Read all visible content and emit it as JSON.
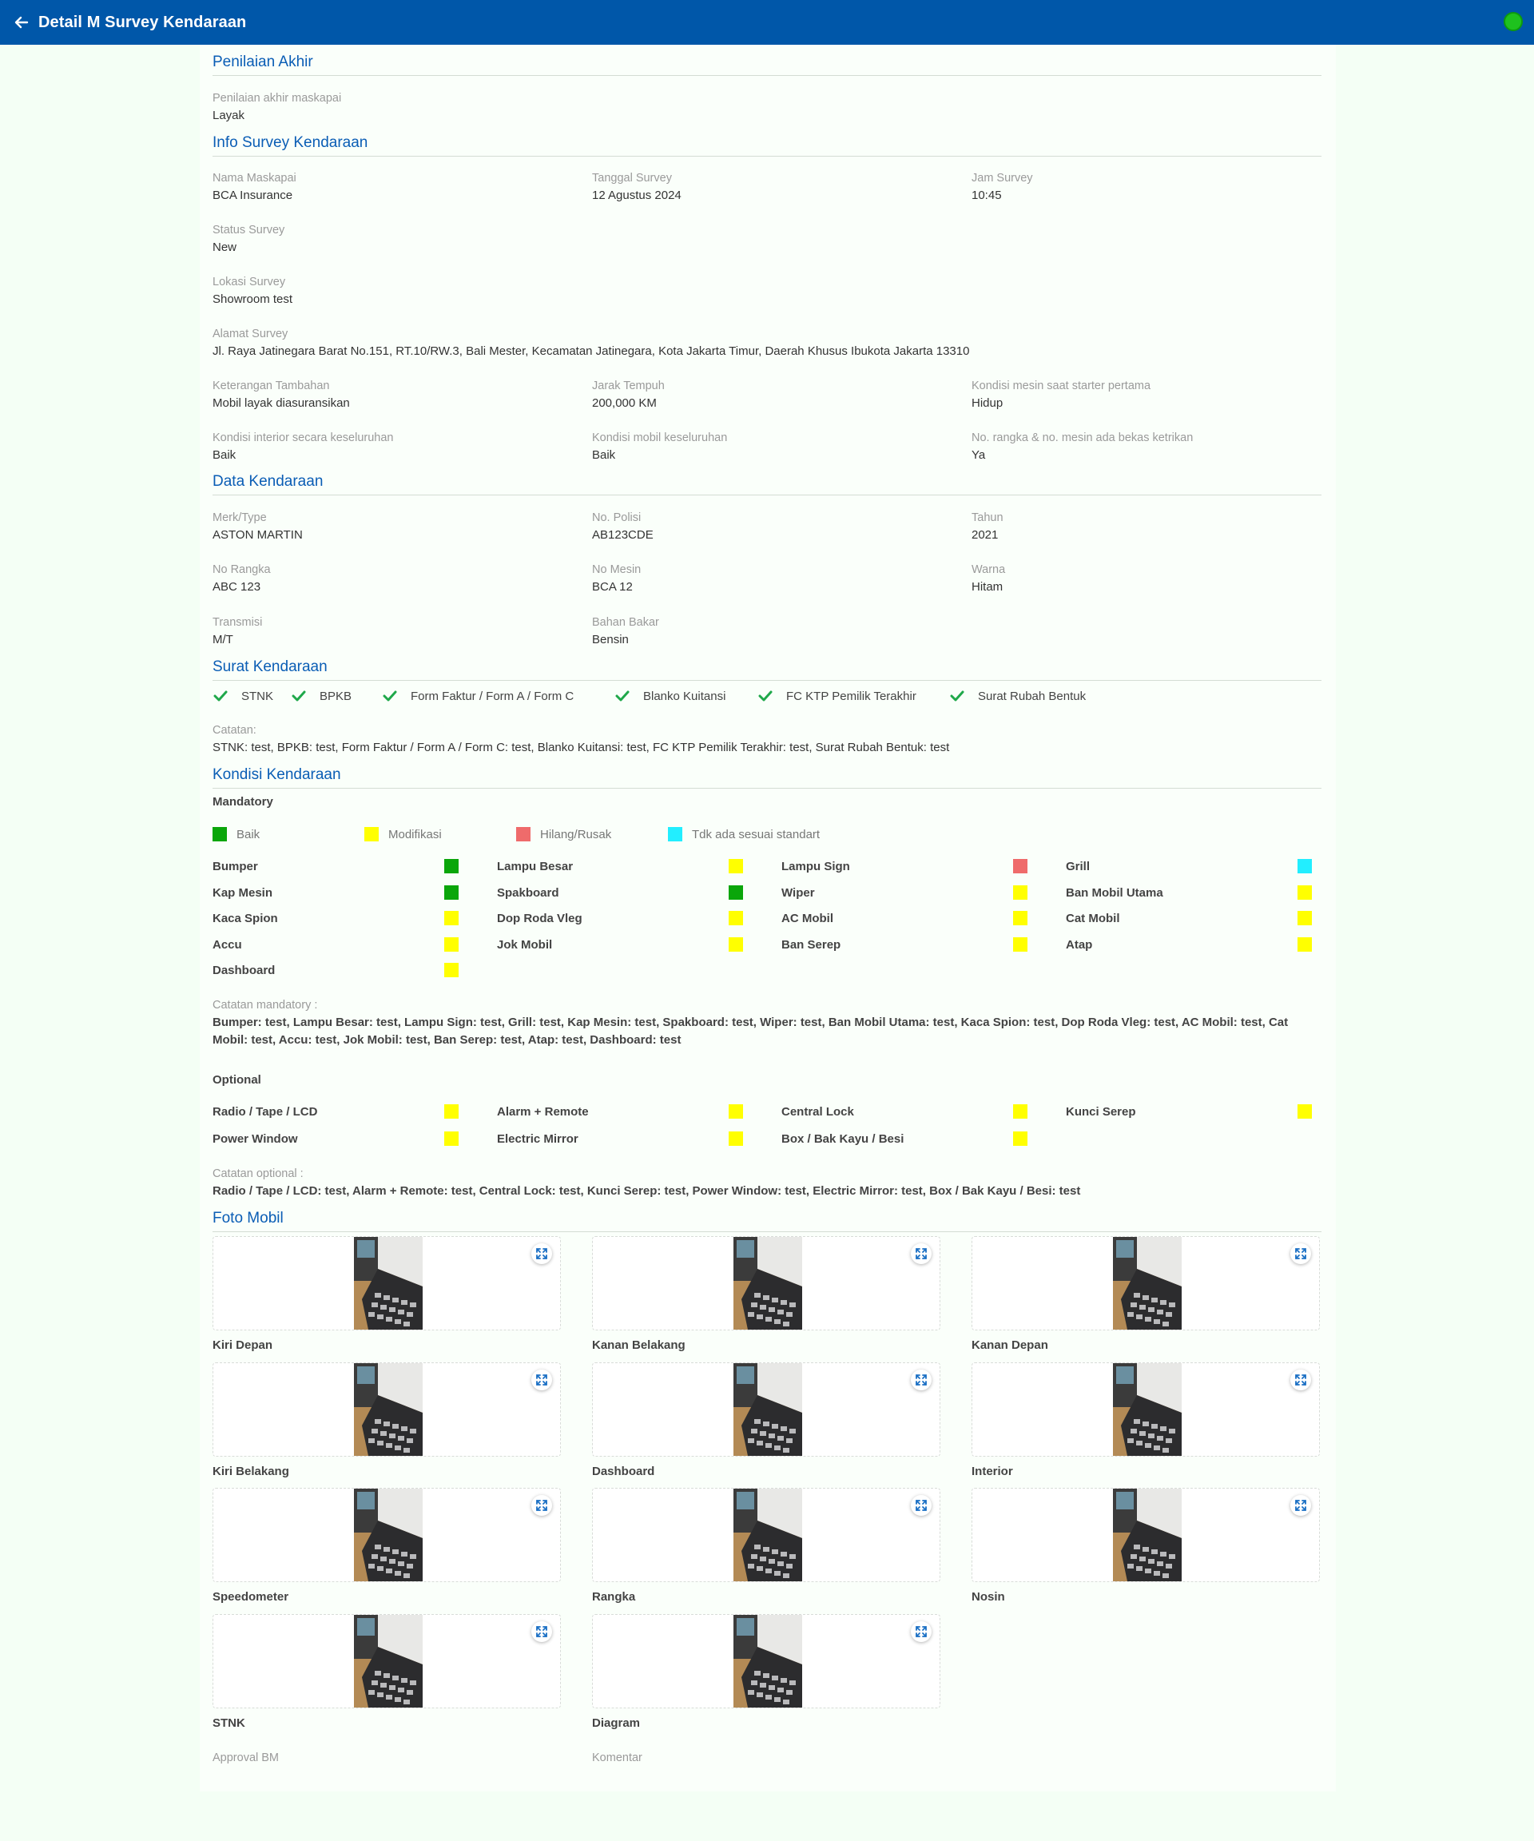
{
  "header": {
    "title": "Detail M Survey Kendaraan",
    "back_icon": "arrow-left-icon"
  },
  "status_indicator": {
    "color": "#1ec21e"
  },
  "penilaian_akhir": {
    "title": "Penilaian Akhir",
    "label": "Penilaian akhir maskapai",
    "value": "Layak"
  },
  "info_survey": {
    "title": "Info Survey Kendaraan",
    "nama_maskapai": {
      "label": "Nama Maskapai",
      "value": "BCA Insurance"
    },
    "tanggal_survey": {
      "label": "Tanggal Survey",
      "value": "12 Agustus 2024"
    },
    "jam_survey": {
      "label": "Jam Survey",
      "value": "10:45"
    },
    "status_survey": {
      "label": "Status Survey",
      "value": "New"
    },
    "lokasi_survey": {
      "label": "Lokasi Survey",
      "value": "Showroom test"
    },
    "alamat_survey": {
      "label": "Alamat Survey",
      "value": "Jl. Raya Jatinegara Barat No.151, RT.10/RW.3, Bali Mester, Kecamatan Jatinegara, Kota Jakarta Timur, Daerah Khusus Ibukota Jakarta 13310"
    },
    "keterangan": {
      "label": "Keterangan Tambahan",
      "value": "Mobil layak diasuransikan"
    },
    "jarak_tempuh": {
      "label": "Jarak Tempuh",
      "value": "200,000 KM"
    },
    "kondisi_mesin": {
      "label": "Kondisi mesin saat starter pertama",
      "value": "Hidup"
    },
    "kondisi_interior": {
      "label": "Kondisi interior secara keseluruhan",
      "value": "Baik"
    },
    "kondisi_mobil": {
      "label": "Kondisi mobil keseluruhan",
      "value": "Baik"
    },
    "rangka_mesin": {
      "label": "No. rangka & no. mesin ada bekas ketrikan",
      "value": "Ya"
    }
  },
  "data_kendaraan": {
    "title": "Data Kendaraan",
    "merk": {
      "label": "Merk/Type",
      "value": "ASTON MARTIN"
    },
    "polisi": {
      "label": "No. Polisi",
      "value": "AB123CDE"
    },
    "tahun": {
      "label": "Tahun",
      "value": "2021"
    },
    "rangka": {
      "label": "No Rangka",
      "value": "ABC 123"
    },
    "mesin": {
      "label": "No Mesin",
      "value": "BCA 12"
    },
    "warna": {
      "label": "Warna",
      "value": "Hitam"
    },
    "transmisi": {
      "label": "Transmisi",
      "value": "M/T"
    },
    "bahan_bakar": {
      "label": "Bahan Bakar",
      "value": "Bensin"
    }
  },
  "surat": {
    "title": "Surat Kendaraan",
    "items": [
      "STNK",
      "BPKB",
      "Form Faktur / Form A / Form C",
      "Blanko Kuitansi",
      "FC KTP Pemilik Terakhir",
      "Surat Rubah Bentuk"
    ],
    "catatan_label": "Catatan:",
    "catatan": "STNK: test, BPKB: test, Form Faktur / Form A / Form C: test, Blanko Kuitansi: test, FC KTP Pemilik Terakhir: test, Surat Rubah Bentuk: test"
  },
  "kondisi": {
    "title": "Kondisi Kendaraan",
    "mandatory_label": "Mandatory",
    "legend": [
      {
        "label": "Baik",
        "color": "#0aa60a"
      },
      {
        "label": "Modifikasi",
        "color": "#ffff00"
      },
      {
        "label": "Hilang/Rusak",
        "color": "#ef6b6b"
      },
      {
        "label": "Tdk ada sesuai standart",
        "color": "#22eeff"
      }
    ],
    "mandatory": [
      {
        "name": "Bumper",
        "color": "#0aa60a"
      },
      {
        "name": "Lampu Besar",
        "color": "#ffff00"
      },
      {
        "name": "Lampu Sign",
        "color": "#ef6b6b"
      },
      {
        "name": "Grill",
        "color": "#22eeff"
      },
      {
        "name": "Kap Mesin",
        "color": "#0aa60a"
      },
      {
        "name": "Spakboard",
        "color": "#0aa60a"
      },
      {
        "name": "Wiper",
        "color": "#ffff00"
      },
      {
        "name": "Ban Mobil Utama",
        "color": "#ffff00"
      },
      {
        "name": "Kaca Spion",
        "color": "#ffff00"
      },
      {
        "name": "Dop Roda Vleg",
        "color": "#ffff00"
      },
      {
        "name": "AC Mobil",
        "color": "#ffff00"
      },
      {
        "name": "Cat Mobil",
        "color": "#ffff00"
      },
      {
        "name": "Accu",
        "color": "#ffff00"
      },
      {
        "name": "Jok Mobil",
        "color": "#ffff00"
      },
      {
        "name": "Ban Serep",
        "color": "#ffff00"
      },
      {
        "name": "Atap",
        "color": "#ffff00"
      },
      {
        "name": "Dashboard",
        "color": "#ffff00"
      }
    ],
    "catatan_mandatory_label": "Catatan mandatory :",
    "catatan_mandatory": "Bumper: test, Lampu Besar: test, Lampu Sign: test, Grill: test, Kap Mesin: test, Spakboard: test, Wiper: test, Ban Mobil Utama: test, Kaca Spion: test, Dop Roda Vleg: test, AC Mobil: test, Cat Mobil: test, Accu: test, Jok Mobil: test, Ban Serep: test, Atap: test, Dashboard: test",
    "optional_label": "Optional",
    "optional": [
      {
        "name": "Radio / Tape / LCD",
        "color": "#ffff00"
      },
      {
        "name": "Alarm + Remote",
        "color": "#ffff00"
      },
      {
        "name": "Central Lock",
        "color": "#ffff00"
      },
      {
        "name": "Kunci Serep",
        "color": "#ffff00"
      },
      {
        "name": "Power Window",
        "color": "#ffff00"
      },
      {
        "name": "Electric Mirror",
        "color": "#ffff00"
      },
      {
        "name": "Box / Bak Kayu / Besi",
        "color": "#ffff00"
      }
    ],
    "catatan_optional_label": "Catatan optional :",
    "catatan_optional": "Radio / Tape / LCD: test, Alarm + Remote: test, Central Lock: test, Kunci Serep: test, Power Window: test, Electric Mirror: test, Box / Bak Kayu / Besi: test"
  },
  "foto": {
    "title": "Foto Mobil",
    "items": [
      "Kiri Depan",
      "Kanan Belakang",
      "Kanan Depan",
      "Kiri Belakang",
      "Dashboard",
      "Interior",
      "Speedometer",
      "Rangka",
      "Nosin",
      "STNK",
      "Diagram"
    ],
    "expand_icon": "expand-icon"
  },
  "approval": {
    "approval_bm": {
      "label": "Approval BM",
      "value": "-"
    },
    "komentar": {
      "label": "Komentar",
      "value": "-"
    }
  }
}
